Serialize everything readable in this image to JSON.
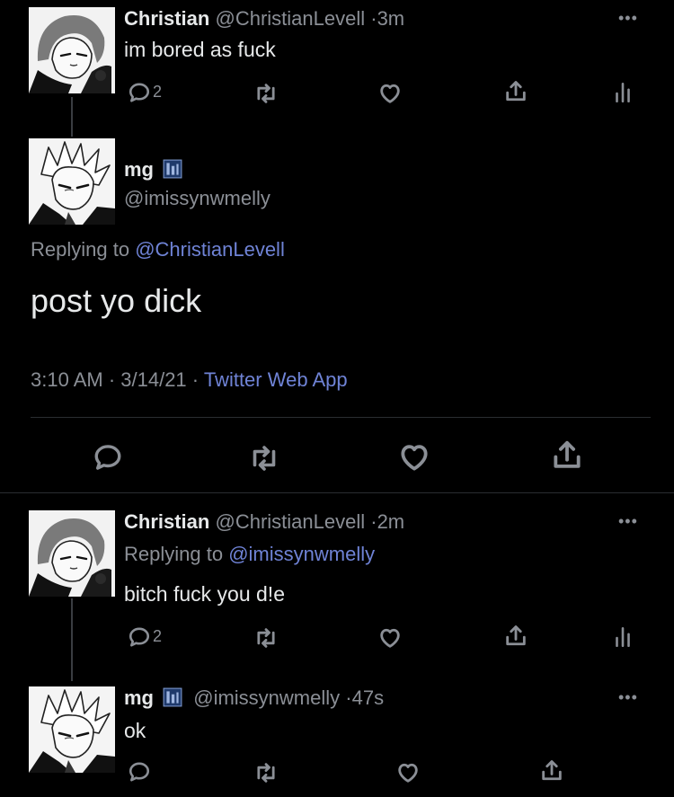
{
  "tweets": [
    {
      "display_name": "Christian",
      "handle": "@ChristianLevell",
      "sep": "·",
      "time": "3m",
      "text": "im bored as fuck",
      "reply_count": "2"
    },
    {
      "display_name": "mg",
      "handle": "@imissynwmelly",
      "replying_prefix": "Replying to",
      "replying_to": "@ChristianLevell",
      "text": "post yo dick",
      "timestamp": "3:10 AM · 3/14/21 ·",
      "source": "Twitter Web App"
    },
    {
      "display_name": "Christian",
      "handle": "@ChristianLevell",
      "sep": "·",
      "time": "2m",
      "replying_prefix": "Replying to",
      "replying_to": "@imissynwmelly",
      "text": "bitch fuck you d!e",
      "reply_count": "2"
    },
    {
      "display_name": "mg",
      "handle": "@imissynwmelly",
      "sep": "·",
      "time": "47s",
      "text": "ok"
    }
  ],
  "more_glyph": "•••",
  "icons": {
    "reply": "reply-icon",
    "retweet": "retweet-icon",
    "like": "heart-icon",
    "share": "share-icon",
    "analytics": "analytics-icon",
    "more": "more-icon"
  },
  "colors": {
    "background": "#000000",
    "text": "#e7e9ea",
    "muted": "#8b8f96",
    "link": "#6f83d6"
  }
}
